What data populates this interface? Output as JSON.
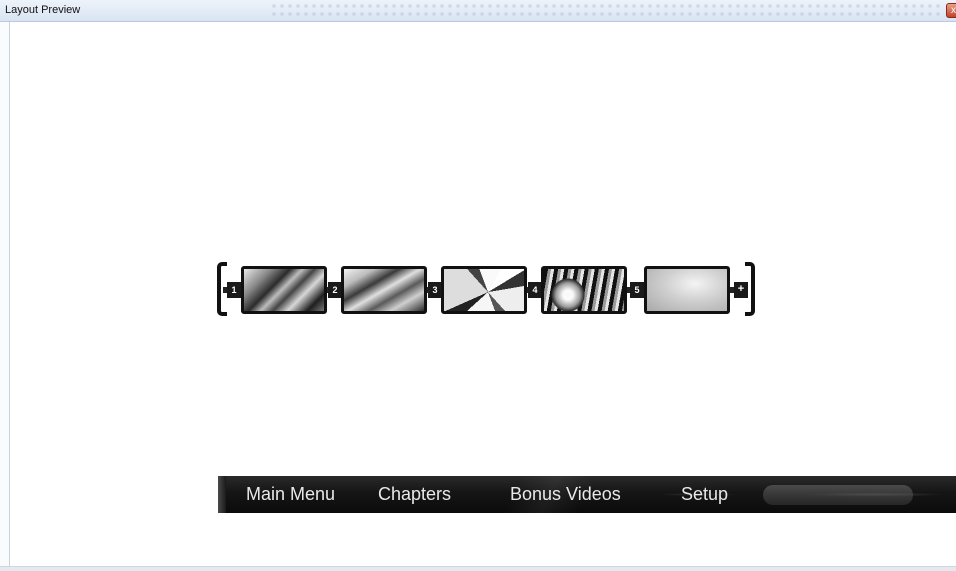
{
  "window": {
    "title": "Layout Preview",
    "close_label": "x"
  },
  "chapters": {
    "items": [
      {
        "number": "1"
      },
      {
        "number": "2"
      },
      {
        "number": "3"
      },
      {
        "number": "4"
      },
      {
        "number": "5"
      }
    ],
    "add_label": "+"
  },
  "menu": {
    "items": [
      {
        "label": "Main Menu"
      },
      {
        "label": "Chapters"
      },
      {
        "label": "Bonus Videos"
      },
      {
        "label": "Setup"
      }
    ]
  }
}
